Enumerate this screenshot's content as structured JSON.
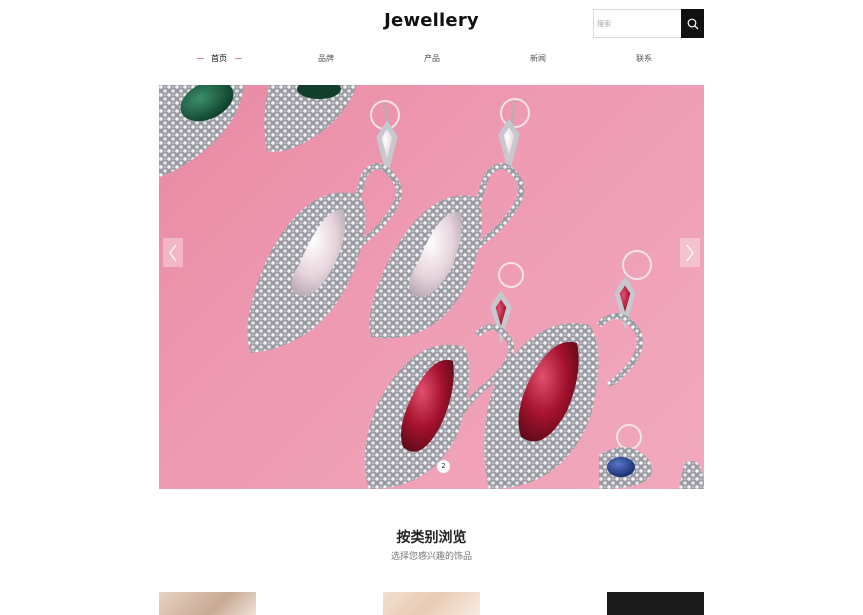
{
  "header": {
    "logo": "Jewellery",
    "search": {
      "placeholder": "搜索"
    }
  },
  "nav": {
    "items": [
      {
        "label": "首页",
        "active": true
      },
      {
        "label": "品牌"
      },
      {
        "label": "产品"
      },
      {
        "label": "新闻"
      },
      {
        "label": "联系"
      }
    ]
  },
  "banner": {
    "current_slide": "2",
    "image": "pink-background-jewel-drop-earrings",
    "colors": {
      "background": "#ee9bb3",
      "accent": "#e08a9a"
    }
  },
  "section": {
    "title": "按类别浏览",
    "subtitle": "选择您感兴趣的饰品"
  },
  "categories": [
    {
      "image": "beige-marble-thumbnail"
    },
    {
      "image": "pearl-thumbnail"
    },
    {
      "image": "black-thumbnail"
    }
  ]
}
